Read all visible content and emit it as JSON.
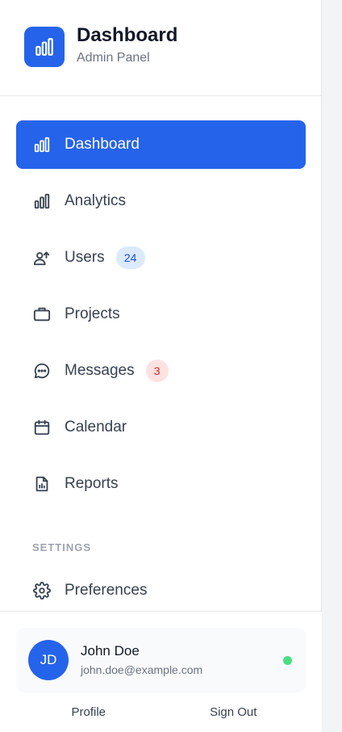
{
  "brand": {
    "title": "Dashboard",
    "subtitle": "Admin Panel",
    "logo_icon": "bar-chart-icon",
    "accent_color": "#2563eb"
  },
  "nav": {
    "items": [
      {
        "label": "Dashboard",
        "icon": "bar-chart-icon",
        "active": true
      },
      {
        "label": "Analytics",
        "icon": "bar-chart-icon"
      },
      {
        "label": "Users",
        "icon": "users-icon",
        "badge": "24",
        "badge_color": "#dbeafe"
      },
      {
        "label": "Projects",
        "icon": "briefcase-icon"
      },
      {
        "label": "Messages",
        "icon": "message-icon",
        "badge": "3",
        "badge_color": "#fee2e2"
      },
      {
        "label": "Calendar",
        "icon": "calendar-icon"
      },
      {
        "label": "Reports",
        "icon": "report-icon"
      }
    ]
  },
  "settings": {
    "section_label": "SETTINGS",
    "items": [
      {
        "label": "Preferences",
        "icon": "gear-icon"
      }
    ]
  },
  "user": {
    "initials": "JD",
    "name": "John Doe",
    "email": "john.doe@example.com",
    "status_color": "#4ade80"
  },
  "footer": {
    "profile_label": "Profile",
    "signout_label": "Sign Out"
  }
}
